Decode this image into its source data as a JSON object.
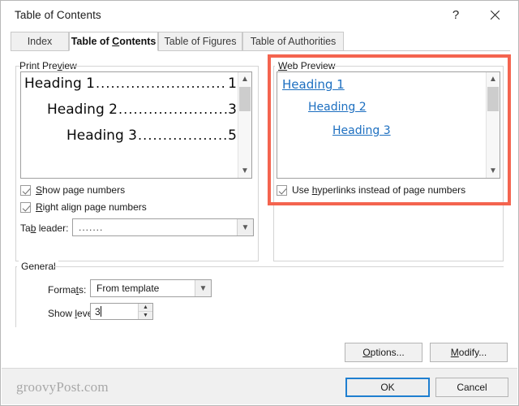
{
  "window": {
    "title": "Table of Contents",
    "help_icon": "question-mark-icon",
    "close_icon": "close-icon"
  },
  "tabs": [
    {
      "label": "Index",
      "active": false
    },
    {
      "label": "Table of Contents",
      "active": true,
      "accel": "C"
    },
    {
      "label": "Table of Figures",
      "active": false
    },
    {
      "label": "Table of Authorities",
      "active": false
    }
  ],
  "print_preview": {
    "group_label": "Print Preview",
    "entries": [
      {
        "text": "Heading 1",
        "leader": "...................................",
        "page": "1",
        "indent": 0
      },
      {
        "text": "Heading 2",
        "leader": "..............................",
        "page": "3",
        "indent": 1
      },
      {
        "text": "Heading 3",
        "leader": "........................",
        "page": "5",
        "indent": 2
      }
    ],
    "scrollbar": {
      "up_icon": "chevron-up-icon",
      "down_icon": "chevron-down-icon"
    },
    "show_page_numbers": {
      "label": "Show page numbers",
      "checked": true
    },
    "right_align_page_numbers": {
      "label": "Right align page numbers",
      "checked": true
    },
    "tab_leader": {
      "label": "Tab leader:",
      "value": ".......",
      "arrow_icon": "chevron-down-icon"
    }
  },
  "web_preview": {
    "group_label": "Web Preview",
    "entries": [
      {
        "text": "Heading 1",
        "indent": 0
      },
      {
        "text": "Heading 2",
        "indent": 1
      },
      {
        "text": "Heading 3",
        "indent": 2
      }
    ],
    "scrollbar": {
      "up_icon": "chevron-up-icon",
      "down_icon": "chevron-down-icon"
    },
    "use_hyperlinks": {
      "label": "Use hyperlinks instead of page numbers",
      "checked": true
    }
  },
  "general": {
    "group_label": "General",
    "formats": {
      "label": "Formats:",
      "value": "From template",
      "arrow_icon": "chevron-down-icon"
    },
    "show_levels": {
      "label": "Show levels:",
      "value": "3",
      "up_icon": "spinner-up-icon",
      "down_icon": "spinner-down-icon"
    }
  },
  "buttons": {
    "options": "Options...",
    "modify": "Modify...",
    "ok": "OK",
    "cancel": "Cancel"
  },
  "watermark": "groovyPost.com",
  "colors": {
    "hyperlink": "#1d6fc0",
    "annotation": "#f4644f",
    "focus": "#1f7fd0"
  }
}
